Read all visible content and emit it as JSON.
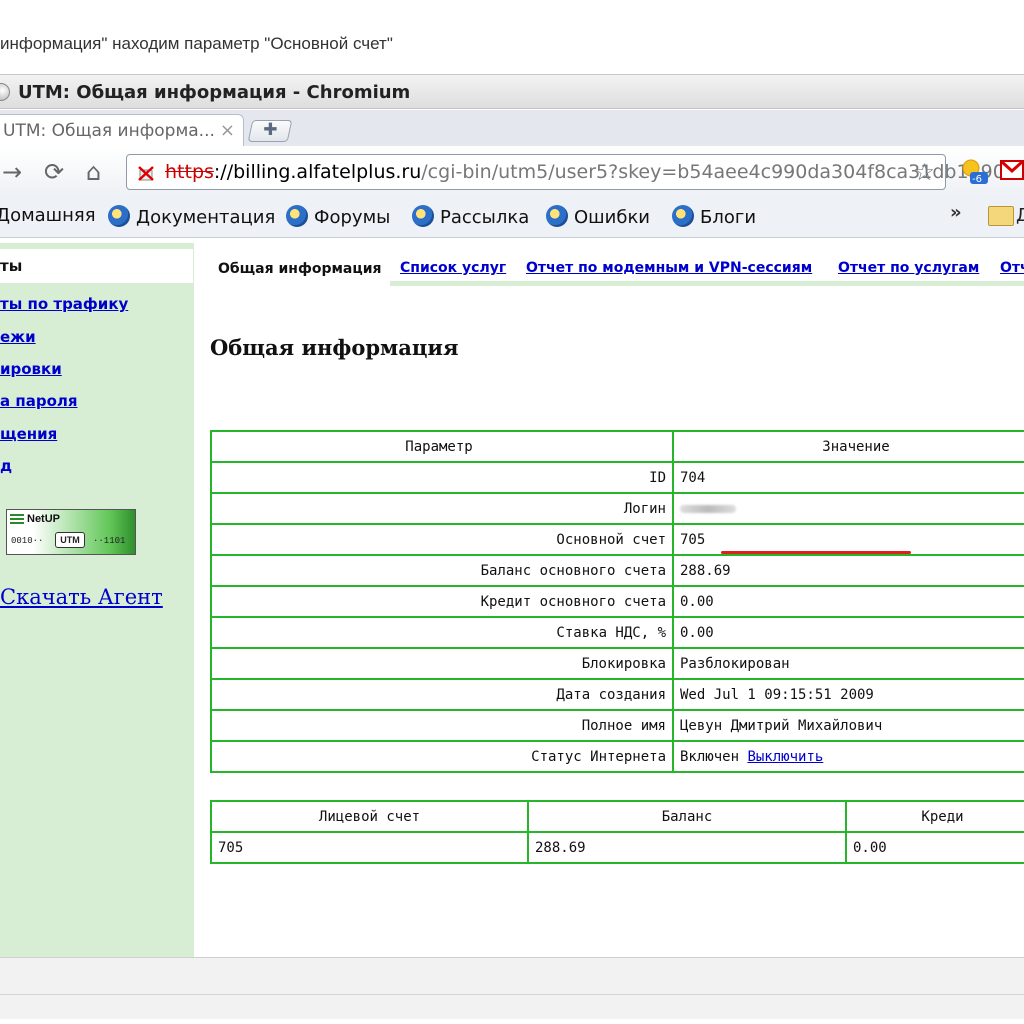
{
  "caption": "информация\" находим параметр \"Основной счет\"",
  "window": {
    "title": "UTM: Общая информация - Chromium"
  },
  "tab": {
    "label": "UTM: Общая информа...",
    "close": "×"
  },
  "toolbar": {
    "url_scheme": "https",
    "url_host": "://billing.alfatelplus.ru",
    "url_rest": "/cgi-bin/utm5/user5?skey=b54aee4c990da304f8ca31db1190",
    "ext_badge": "-6"
  },
  "bookmarks": [
    "Домашняя",
    "Документация",
    "Форумы",
    "Рассылка",
    "Ошибки",
    "Блоги"
  ],
  "bookmarks_more": "»",
  "bookmarks_folder_text": "Д",
  "sidebar": {
    "top_label": "ты",
    "links": [
      "ты по трафику",
      "ежи",
      "ировки",
      "а пароля",
      "щения",
      "д"
    ],
    "logo": {
      "brand": "NetUP",
      "bits_left": "0010··",
      "product": "UTM",
      "bits_right": "··1101"
    },
    "agent_link": "Скачать Агент"
  },
  "content_tabs": {
    "active": "Общая информация",
    "links": [
      "Список услуг",
      "Отчет по модемным и VPN-сессиям",
      "Отчет по услугам",
      "Отч"
    ]
  },
  "heading": "Общая информация",
  "info_table": {
    "headers": [
      "Параметр",
      "Значение"
    ],
    "rows": [
      {
        "param": "ID",
        "value": "704"
      },
      {
        "param": "Логин",
        "value": ""
      },
      {
        "param": "Основной счет",
        "value": "705"
      },
      {
        "param": "Баланс основного счета",
        "value": "288.69"
      },
      {
        "param": "Кредит основного счета",
        "value": "0.00"
      },
      {
        "param": "Ставка НДС, %",
        "value": "0.00"
      },
      {
        "param": "Блокировка",
        "value": "Разблокирован"
      },
      {
        "param": "Дата создания",
        "value": "Wed Jul 1 09:15:51 2009"
      },
      {
        "param": "Полное имя",
        "value": "Цевун Дмитрий Михайлович"
      },
      {
        "param": "Статус Интернета",
        "value": "Включен",
        "action": "Выключить"
      }
    ]
  },
  "account_table": {
    "headers": [
      "Лицевой счет",
      "Баланс",
      "Креди"
    ],
    "rows": [
      [
        "705",
        "288.69",
        "0.00"
      ]
    ]
  },
  "colors": {
    "grid": "#27b52a",
    "sidebar": "#d8eed4",
    "link": "#0000cc",
    "highlight": "#e0201a"
  }
}
